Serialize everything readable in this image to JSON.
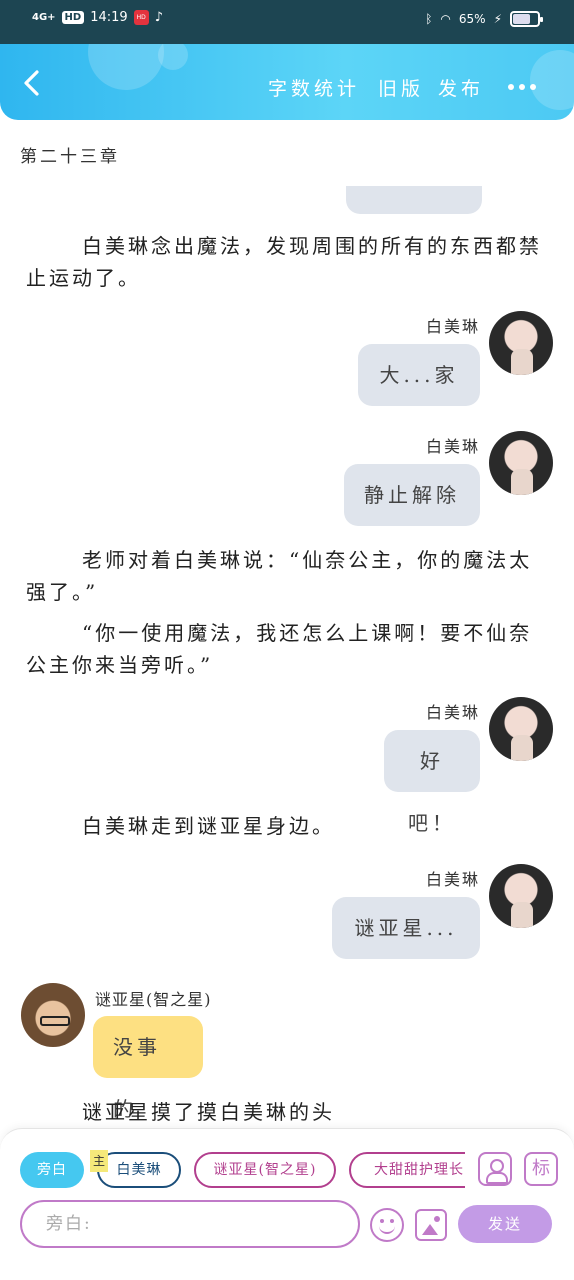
{
  "status": {
    "network": "4G+",
    "hd": "HD",
    "time": "14:19",
    "app_badge": "HD",
    "battery": "65%"
  },
  "header": {
    "back": "<",
    "word_count": "字数统计",
    "old_version": "旧版",
    "publish": "发布"
  },
  "chapter_title": "第二十三章",
  "messages": {
    "narr1": "白美琳念出魔法，发现周围的所有的东西都禁止运动了。",
    "name1": "白美琳",
    "bubble1": "大...家",
    "name2": "白美琳",
    "bubble2": "静止解除",
    "narr2": "老师对着白美琳说：“仙奈公主，你的魔法太强了。”",
    "narr3": "“你一使用魔法，我还怎么上课啊！要不仙奈公主你来当旁听。”",
    "name3": "白美琳",
    "bubble3": "好吧！",
    "narr4": "白美琳走到谜亚星身边。",
    "name4": "白美琳",
    "bubble4": "谜亚星...",
    "name5": "谜亚星(智之星)",
    "bubble5": "没事的",
    "narr5": "谜亚星摸了摸白美琳的头"
  },
  "composer": {
    "roles": [
      "旁白",
      "白美琳",
      "谜亚星(智之星)",
      "大甜甜护理长"
    ],
    "main_tag": "主",
    "tag_icon": "标",
    "input_placeholder": "旁白:",
    "send": "发送"
  },
  "colors": {
    "header": "#3cc3f2",
    "status_bar": "#1d4552",
    "bubble_gray": "#dfe4ec",
    "bubble_yellow": "#fde082",
    "accent_purple": "#c07ac8",
    "send": "#c39be6"
  }
}
